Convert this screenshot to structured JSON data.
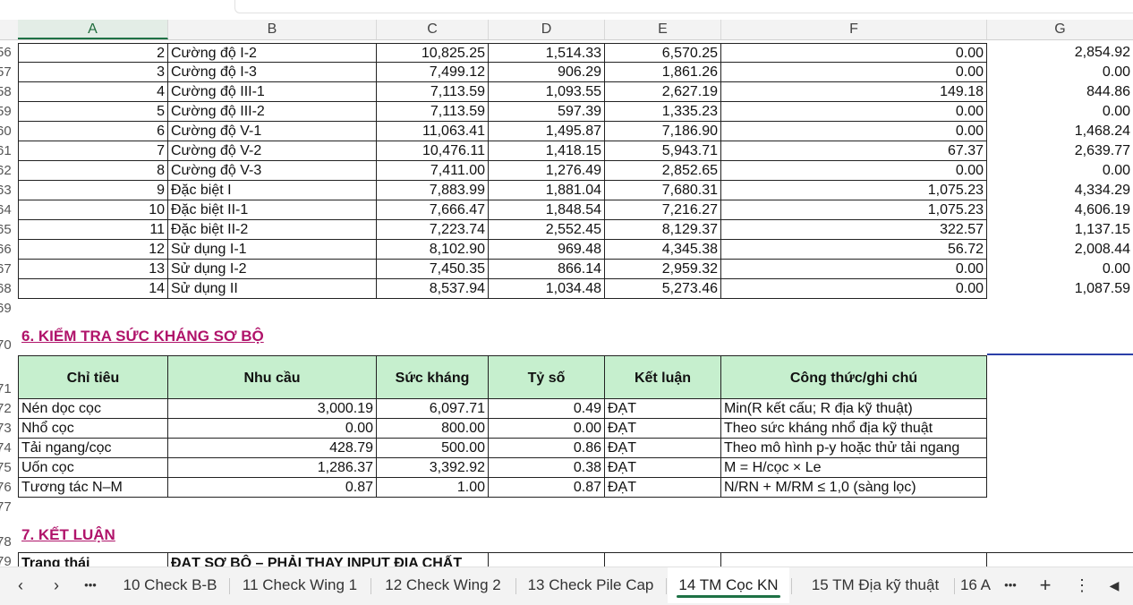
{
  "columns": [
    "A",
    "B",
    "C",
    "D",
    "E",
    "F",
    "G"
  ],
  "row_numbers": [
    "56",
    "57",
    "58",
    "59",
    "60",
    "61",
    "62",
    "63",
    "64",
    "65",
    "66",
    "67",
    "68",
    "69",
    "70",
    "71",
    "72",
    "73",
    "74",
    "75",
    "76",
    "77",
    "78",
    "79"
  ],
  "load_rows": [
    {
      "n": "2",
      "name": "Cường độ I-2",
      "c": "10,825.25",
      "d": "1,514.33",
      "e": "6,570.25",
      "f": "0.00",
      "g": "2,854.92"
    },
    {
      "n": "3",
      "name": "Cường độ I-3",
      "c": "7,499.12",
      "d": "906.29",
      "e": "1,861.26",
      "f": "0.00",
      "g": "0.00"
    },
    {
      "n": "4",
      "name": "Cường độ III-1",
      "c": "7,113.59",
      "d": "1,093.55",
      "e": "2,627.19",
      "f": "149.18",
      "g": "844.86"
    },
    {
      "n": "5",
      "name": "Cường độ III-2",
      "c": "7,113.59",
      "d": "597.39",
      "e": "1,335.23",
      "f": "0.00",
      "g": "0.00"
    },
    {
      "n": "6",
      "name": "Cường độ V-1",
      "c": "11,063.41",
      "d": "1,495.87",
      "e": "7,186.90",
      "f": "0.00",
      "g": "1,468.24"
    },
    {
      "n": "7",
      "name": "Cường độ V-2",
      "c": "10,476.11",
      "d": "1,418.15",
      "e": "5,943.71",
      "f": "67.37",
      "g": "2,639.77"
    },
    {
      "n": "8",
      "name": "Cường độ V-3",
      "c": "7,411.00",
      "d": "1,276.49",
      "e": "2,852.65",
      "f": "0.00",
      "g": "0.00"
    },
    {
      "n": "9",
      "name": "Đặc biệt I",
      "c": "7,883.99",
      "d": "1,881.04",
      "e": "7,680.31",
      "f": "1,075.23",
      "g": "4,334.29"
    },
    {
      "n": "10",
      "name": "Đặc biệt II-1",
      "c": "7,666.47",
      "d": "1,848.54",
      "e": "7,216.27",
      "f": "1,075.23",
      "g": "4,606.19"
    },
    {
      "n": "11",
      "name": "Đặc biệt II-2",
      "c": "7,223.74",
      "d": "2,552.45",
      "e": "8,129.37",
      "f": "322.57",
      "g": "1,137.15"
    },
    {
      "n": "12",
      "name": "Sử dụng I-1",
      "c": "8,102.90",
      "d": "969.48",
      "e": "4,345.38",
      "f": "56.72",
      "g": "2,008.44"
    },
    {
      "n": "13",
      "name": "Sử dụng I-2",
      "c": "7,450.35",
      "d": "866.14",
      "e": "2,959.32",
      "f": "0.00",
      "g": "0.00"
    },
    {
      "n": "14",
      "name": "Sử dụng II",
      "c": "8,537.94",
      "d": "1,034.48",
      "e": "5,273.46",
      "f": "0.00",
      "g": "1,087.59"
    }
  ],
  "section6_title": "6. KIỂM TRA SỨC KHÁNG SƠ BỘ",
  "check_headers": [
    "Chỉ tiêu",
    "Nhu cầu",
    "Sức kháng",
    "Tỷ số",
    "Kết luận",
    "Công thức/ghi chú"
  ],
  "check_rows": [
    {
      "a": "Nén dọc cọc",
      "b": "3,000.19",
      "c": "6,097.71",
      "d": "0.49",
      "e": "ĐẠT",
      "f": "Min(R kết cấu; R địa kỹ thuật)"
    },
    {
      "a": "Nhổ cọc",
      "b": "0.00",
      "c": "800.00",
      "d": "0.00",
      "e": "ĐẠT",
      "f": "Theo sức kháng nhổ địa kỹ thuật"
    },
    {
      "a": "Tải ngang/cọc",
      "b": "428.79",
      "c": "500.00",
      "d": "0.86",
      "e": "ĐẠT",
      "f": "Theo mô hình p-y hoặc thử tải ngang"
    },
    {
      "a": "Uốn cọc",
      "b": "1,286.37",
      "c": "3,392.92",
      "d": "0.38",
      "e": "ĐẠT",
      "f": "M = H/cọc × Le"
    },
    {
      "a": "Tương tác N–M",
      "b": "0.87",
      "c": "1.00",
      "d": "0.87",
      "e": "ĐẠT",
      "f": "N/RN + M/RM ≤ 1,0 (sàng lọc)"
    }
  ],
  "section7_title": "7. KẾT LUẬN",
  "status_label": "Trạng thái",
  "status_value": "ĐẠT SƠ BỘ – PHẢI THAY INPUT ĐỊA CHẤT",
  "tabs": [
    "10 Check B-B",
    "11 Check Wing 1",
    "12 Check Wing 2",
    "13 Check Pile Cap",
    "14 TM Cọc KN",
    "15 TM Địa kỹ thuật",
    "16 A"
  ],
  "active_tab": "14 TM Cọc KN",
  "nav": {
    "prev": "‹",
    "next": "›",
    "more_left": "•••",
    "more_right": "•••",
    "add": "+",
    "menu": "⋮",
    "scroll": "◀"
  }
}
